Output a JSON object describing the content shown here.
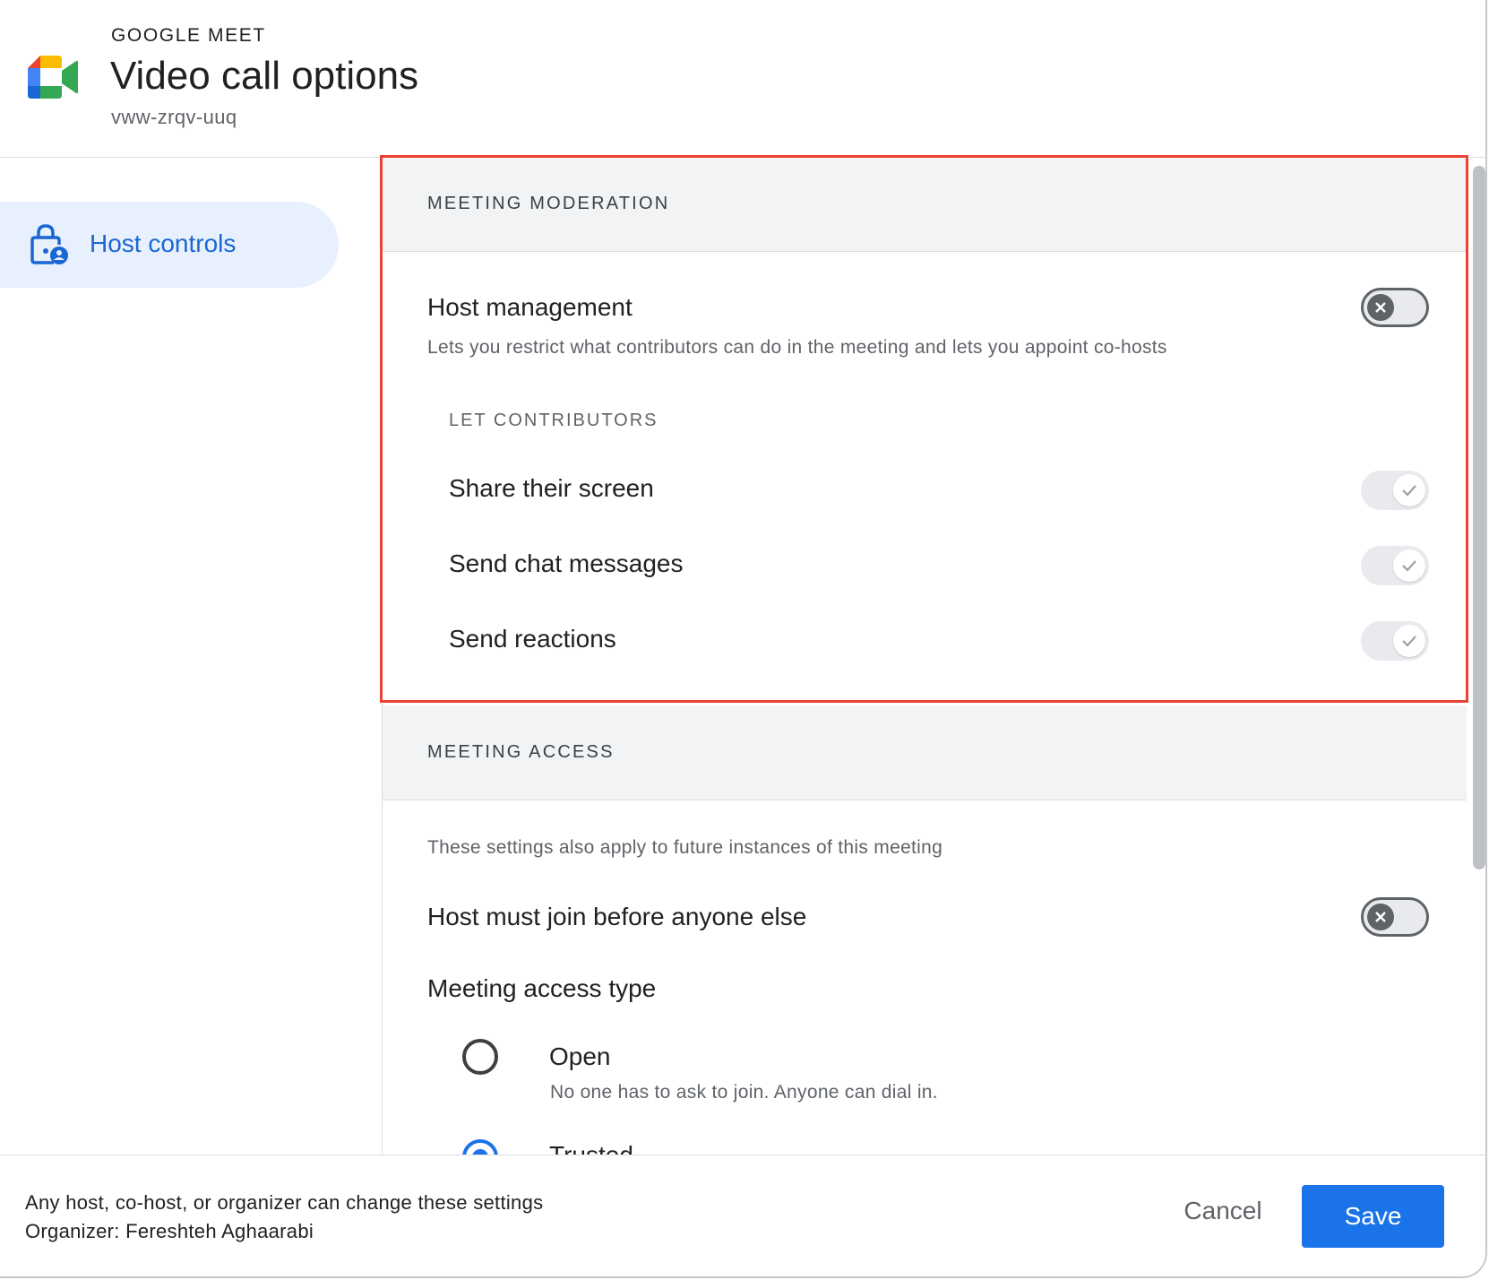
{
  "header": {
    "app_name": "GOOGLE MEET",
    "title": "Video call options",
    "meeting_code": "vww-zrqv-uuq"
  },
  "sidebar": {
    "items": [
      {
        "label": "Host controls",
        "icon": "lock-person-icon",
        "active": true
      }
    ]
  },
  "moderation": {
    "section_title": "MEETING MODERATION",
    "host_management": {
      "label": "Host management",
      "description": "Lets you restrict what contributors can do in the meeting and lets you appoint co-hosts",
      "enabled": false
    },
    "contributors_heading": "LET CONTRIBUTORS",
    "contributors": [
      {
        "label": "Share their screen",
        "enabled": true,
        "disabled": true
      },
      {
        "label": "Send chat messages",
        "enabled": true,
        "disabled": true
      },
      {
        "label": "Send reactions",
        "enabled": true,
        "disabled": true
      }
    ]
  },
  "access": {
    "section_title": "MEETING ACCESS",
    "note": "These settings also apply to future instances of this meeting",
    "host_join_first": {
      "label": "Host must join before anyone else",
      "enabled": false
    },
    "access_type_label": "Meeting access type",
    "options": [
      {
        "label": "Open",
        "description": "No one has to ask to join. Anyone can dial in.",
        "selected": false
      },
      {
        "label": "Trusted",
        "selected": true
      }
    ]
  },
  "footer": {
    "line1": "Any host, co-host, or organizer can change these settings",
    "line2": "Organizer: Fereshteh Aghaarabi",
    "cancel_label": "Cancel",
    "save_label": "Save"
  },
  "colors": {
    "accent": "#1a73e8",
    "highlight_border": "#ea4335",
    "nav_active_bg": "#e8f0fe"
  }
}
